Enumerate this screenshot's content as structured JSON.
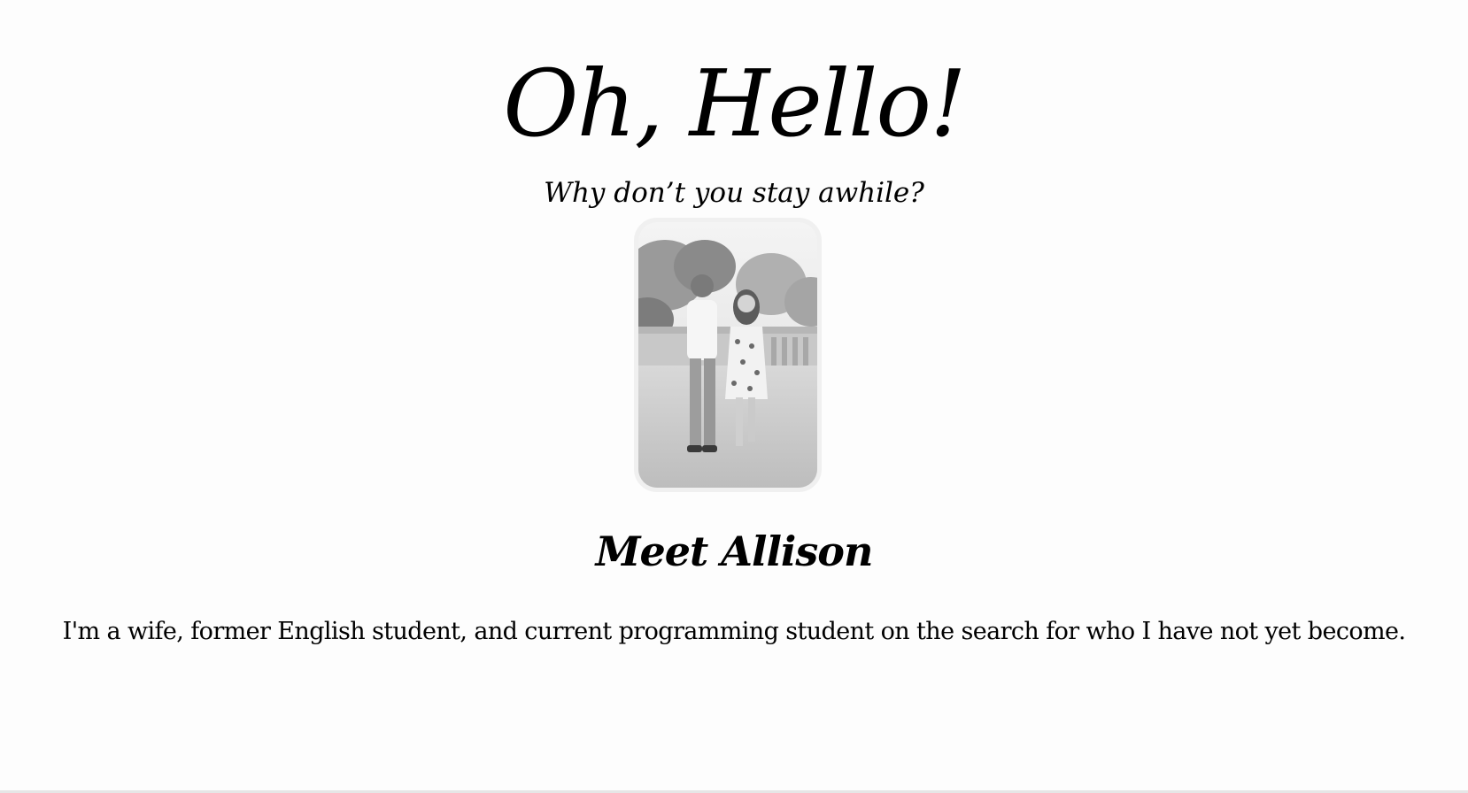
{
  "hero": {
    "title": "Oh, Hello!",
    "subtitle": "Why don’t you stay awhile?"
  },
  "about": {
    "heading": "Meet Allison",
    "bio": "I'm a wife, former English student, and current programming student on the search for who I have not yet become."
  },
  "colors": {
    "background": "#fdfdfd",
    "text": "#000000",
    "photo_border": "#f0f0f0"
  }
}
